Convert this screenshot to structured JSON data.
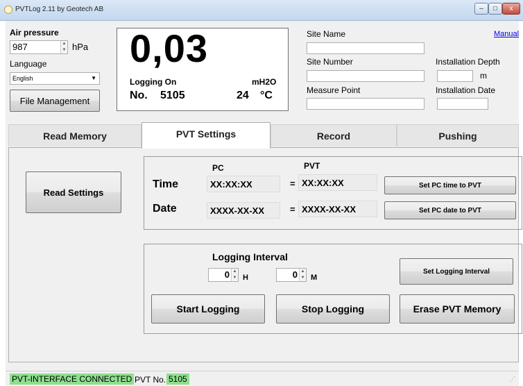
{
  "window": {
    "title": "PVTLog 2.11 by Geotech AB",
    "min_glyph": "–",
    "max_glyph": "□",
    "close_glyph": "x"
  },
  "left": {
    "air_pressure_label": "Air pressure",
    "air_pressure_value": "987",
    "air_pressure_unit": "hPa",
    "language_label": "Language",
    "language_value": "English",
    "file_management_button": "File Management"
  },
  "reading": {
    "value": "0,03",
    "logging_status": "Logging On",
    "unit": "mH2O",
    "number_label": "No.",
    "number_value": "5105",
    "temperature_value": "24",
    "temperature_unit": "°C"
  },
  "site": {
    "manual_link": "Manual",
    "site_name_label": "Site Name",
    "site_name_value": "",
    "site_number_label": "Site Number",
    "site_number_value": "",
    "measure_point_label": "Measure Point",
    "measure_point_value": "",
    "installation_depth_label": "Installation Depth",
    "installation_depth_value": "",
    "installation_depth_unit": "m",
    "installation_date_label": "Installation Date",
    "installation_date_value": ""
  },
  "tabs": [
    {
      "label": "Read Memory",
      "active": false
    },
    {
      "label": "PVT Settings",
      "active": true
    },
    {
      "label": "Record",
      "active": false
    },
    {
      "label": "Pushing",
      "active": false
    }
  ],
  "pvt_settings": {
    "read_settings_button": "Read Settings",
    "pc_header": "PC",
    "pvt_header": "PVT",
    "time_label": "Time",
    "date_label": "Date",
    "pc_time": "XX:XX:XX",
    "pvt_time": "XX:XX:XX",
    "pc_date": "XXXX-XX-XX",
    "pvt_date": "XXXX-XX-XX",
    "equals": "=",
    "set_time_button": "Set PC time to PVT",
    "set_date_button": "Set PC date to PVT",
    "logging_interval_label": "Logging Interval",
    "hours_value": "0",
    "hours_unit": "H",
    "minutes_value": "0",
    "minutes_unit": "M",
    "set_interval_button": "Set Logging Interval",
    "start_logging_button": "Start Logging",
    "stop_logging_button": "Stop Logging",
    "erase_memory_button": "Erase PVT Memory"
  },
  "status": {
    "connection": "PVT-INTERFACE CONNECTED",
    "pvt_no_label": "PVT No.",
    "pvt_no_value": "5105"
  },
  "colors": {
    "status_green": "#8ee08e",
    "link_blue": "#0000ee"
  }
}
